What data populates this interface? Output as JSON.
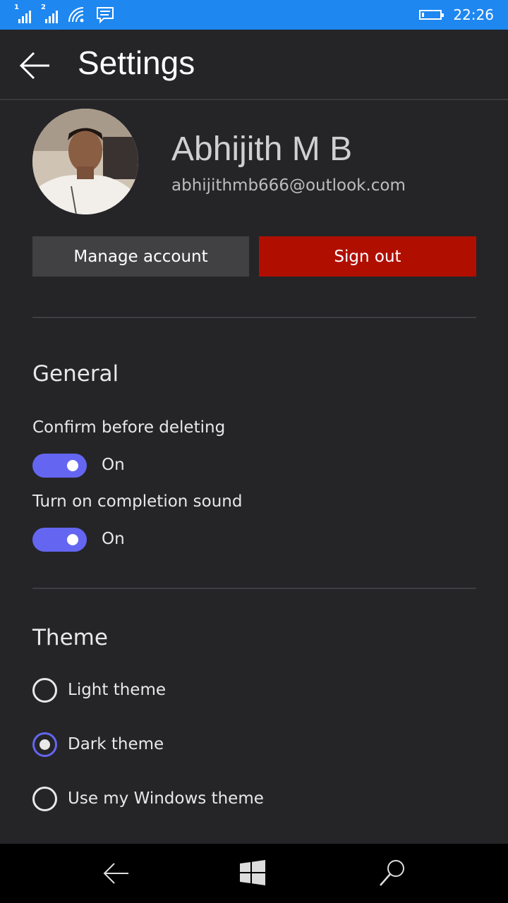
{
  "status_bar": {
    "sim1_label": "1",
    "sim2_label": "2",
    "time": "22:26",
    "icons": [
      "signal-sim1-icon",
      "signal-sim2-icon",
      "wifi-icon",
      "message-icon",
      "battery-icon"
    ],
    "background_color": "#1e87f0"
  },
  "header": {
    "title": "Settings",
    "back_icon": "back-arrow-icon"
  },
  "profile": {
    "name": "Abhijith M B",
    "email": "abhijithmb666@outlook.com",
    "manage_label": "Manage account",
    "signout_label": "Sign out",
    "signout_color": "#b00f00"
  },
  "general": {
    "title": "General",
    "settings": [
      {
        "label": "Confirm before deleting",
        "state": "On"
      },
      {
        "label": "Turn on completion sound",
        "state": "On"
      }
    ],
    "toggle_color": "#6466f2"
  },
  "theme": {
    "title": "Theme",
    "options": [
      {
        "label": "Light theme",
        "selected": false
      },
      {
        "label": "Dark theme",
        "selected": true
      },
      {
        "label": "Use my Windows theme",
        "selected": false
      }
    ]
  },
  "nav_bar": {
    "icons": [
      "nav-back-icon",
      "windows-start-icon",
      "search-icon"
    ]
  }
}
